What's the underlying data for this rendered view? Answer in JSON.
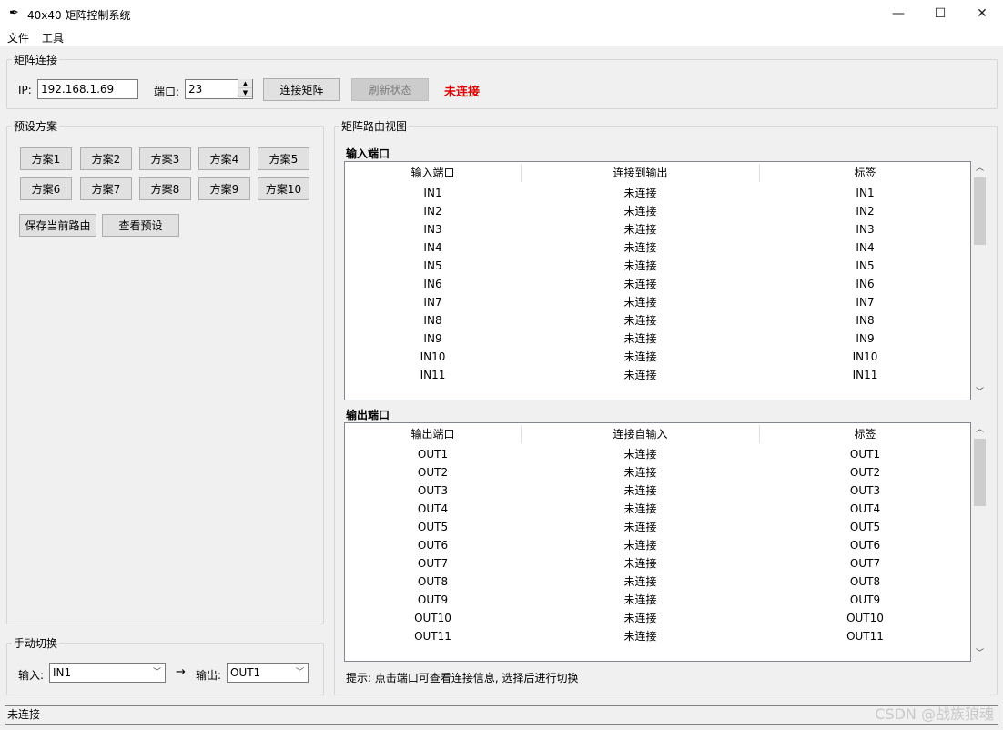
{
  "window": {
    "title": "40x40 矩阵控制系统",
    "icon": "feather-icon"
  },
  "menu": [
    "文件",
    "工具"
  ],
  "connection": {
    "legend": "矩阵连接",
    "ip_label": "IP:",
    "ip_value": "192.168.1.69",
    "port_label": "端口:",
    "port_value": "23",
    "connect_button": "连接矩阵",
    "refresh_button": "刷新状态",
    "status": "未连接",
    "status_color": "#e00000"
  },
  "presets": {
    "legend": "预设方案",
    "buttons": [
      "方案1",
      "方案2",
      "方案3",
      "方案4",
      "方案5",
      "方案6",
      "方案7",
      "方案8",
      "方案9",
      "方案10"
    ],
    "save_button": "保存当前路由",
    "view_button": "查看预设"
  },
  "manual": {
    "legend": "手动切换",
    "input_label": "输入:",
    "input_value": "IN1",
    "arrow": "→",
    "output_label": "输出:",
    "output_value": "OUT1"
  },
  "routing": {
    "legend": "矩阵路由视图",
    "inputs": {
      "title": "输入端口",
      "columns": [
        "输入端口",
        "连接到输出",
        "标签"
      ],
      "rows": [
        [
          "IN1",
          "未连接",
          "IN1"
        ],
        [
          "IN2",
          "未连接",
          "IN2"
        ],
        [
          "IN3",
          "未连接",
          "IN3"
        ],
        [
          "IN4",
          "未连接",
          "IN4"
        ],
        [
          "IN5",
          "未连接",
          "IN5"
        ],
        [
          "IN6",
          "未连接",
          "IN6"
        ],
        [
          "IN7",
          "未连接",
          "IN7"
        ],
        [
          "IN8",
          "未连接",
          "IN8"
        ],
        [
          "IN9",
          "未连接",
          "IN9"
        ],
        [
          "IN10",
          "未连接",
          "IN10"
        ],
        [
          "IN11",
          "未连接",
          "IN11"
        ]
      ]
    },
    "outputs": {
      "title": "输出端口",
      "columns": [
        "输出端口",
        "连接自输入",
        "标签"
      ],
      "rows": [
        [
          "OUT1",
          "未连接",
          "OUT1"
        ],
        [
          "OUT2",
          "未连接",
          "OUT2"
        ],
        [
          "OUT3",
          "未连接",
          "OUT3"
        ],
        [
          "OUT4",
          "未连接",
          "OUT4"
        ],
        [
          "OUT5",
          "未连接",
          "OUT5"
        ],
        [
          "OUT6",
          "未连接",
          "OUT6"
        ],
        [
          "OUT7",
          "未连接",
          "OUT7"
        ],
        [
          "OUT8",
          "未连接",
          "OUT8"
        ],
        [
          "OUT9",
          "未连接",
          "OUT9"
        ],
        [
          "OUT10",
          "未连接",
          "OUT10"
        ],
        [
          "OUT11",
          "未连接",
          "OUT11"
        ]
      ]
    },
    "hint": "提示: 点击端口可查看连接信息, 选择后进行切换"
  },
  "statusbar": "未连接",
  "watermark": "CSDN @战族狼魂"
}
